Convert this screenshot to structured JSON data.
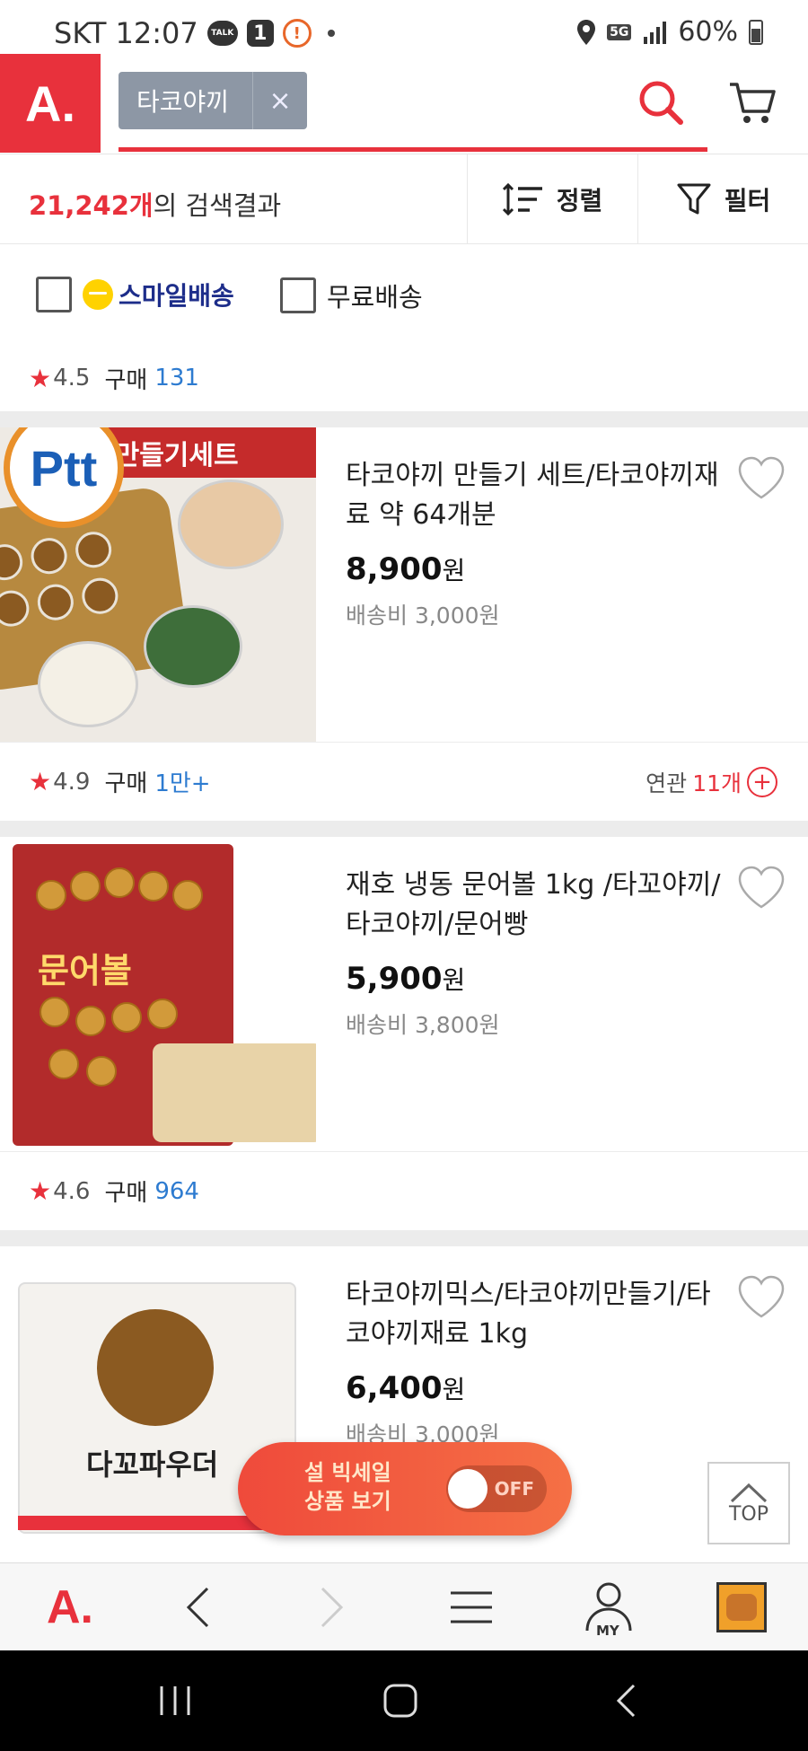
{
  "status_bar": {
    "carrier_time": "SKT 12:07",
    "talk_badge": "TALK",
    "notif_count": "1",
    "network": "5G",
    "battery": "60%"
  },
  "header": {
    "logo": "A.",
    "search_term": "타코야끼",
    "clear_symbol": "×"
  },
  "results": {
    "count": "21,242개",
    "suffix": "의 검색결과",
    "sort_label": "정렬",
    "filter_label": "필터"
  },
  "options": {
    "smile_delivery": "스마일배송",
    "free_shipping": "무료배송"
  },
  "first_meta": {
    "rating": "4.5",
    "buy_label": "구매",
    "buy_count": "131"
  },
  "products": [
    {
      "title": "타코야끼 만들기 세트/타코야끼재료 약 64개분",
      "price": "8,900",
      "won": "원",
      "shipping": "배송비 3,000원",
      "banner": "끼만들기세트",
      "badge": "Ptt",
      "rating": "4.9",
      "buy_label": "구매",
      "buy_count": "1만+",
      "related_label": "연관",
      "related_count": "11개"
    },
    {
      "title": "재호 냉동 문어볼 1kg /타꼬야끼/타코야끼/문어빵",
      "price": "5,900",
      "won": "원",
      "shipping": "배송비 3,800원",
      "pack_label": "문어볼",
      "rating": "4.6",
      "buy_label": "구매",
      "buy_count": "964"
    },
    {
      "title": "타코야끼믹스/타코야끼만들기/타코야끼재료 1kg",
      "price": "6,400",
      "won": "원",
      "shipping": "배송비 3,000원",
      "pack_label": "다꼬파우더"
    }
  ],
  "sale_toggle": {
    "line1": "설 빅세일",
    "line2": "상품 보기",
    "state": "OFF"
  },
  "top_button": "TOP",
  "bottom_nav": {
    "logo": "A.",
    "my": "MY"
  },
  "colors": {
    "accent": "#e8313c",
    "link": "#2d7bd0"
  }
}
